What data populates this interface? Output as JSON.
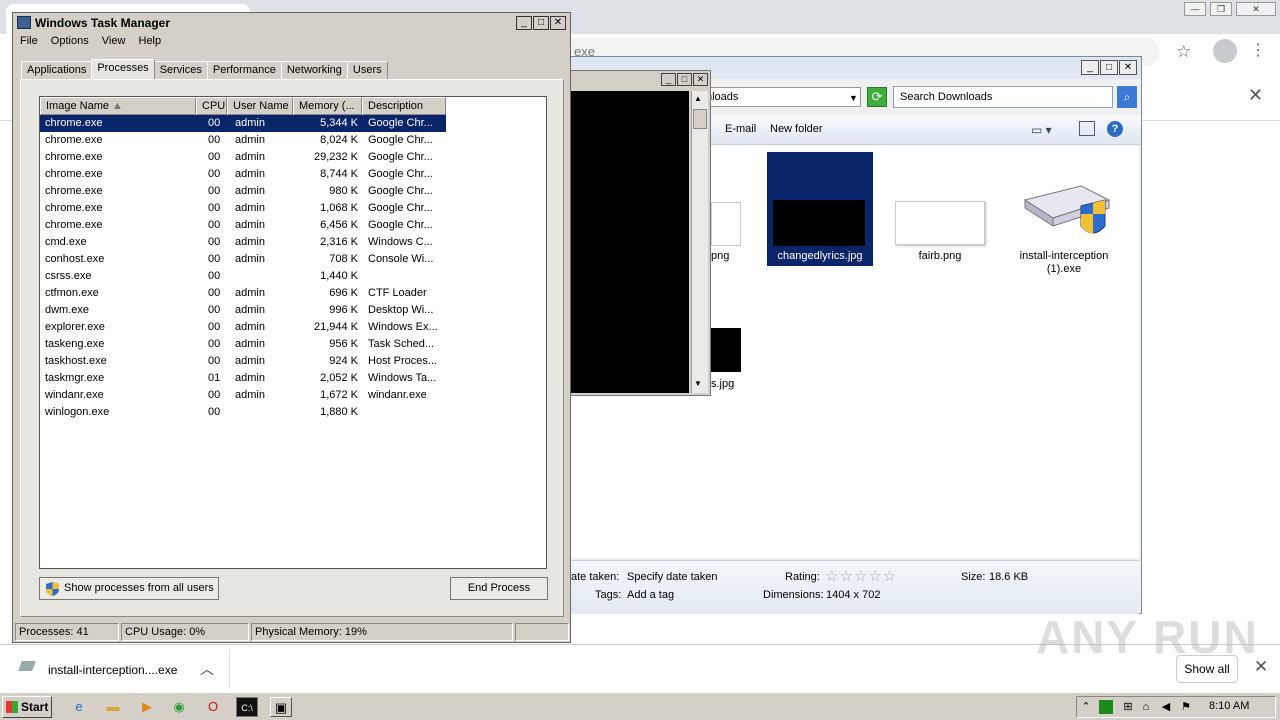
{
  "chrome": {
    "omnibox_text": "exe",
    "window_controls": [
      "—",
      "❐",
      "✕"
    ]
  },
  "explorer": {
    "address": "nloads",
    "search_placeholder": "Search Downloads",
    "toolbar": {
      "email": "E-mail",
      "new_folder": "New folder"
    },
    "files": [
      {
        "name": "changedlyrics.jpg"
      },
      {
        "name": "fairb.png"
      },
      {
        "name": "install-interception (1).exe"
      }
    ],
    "partial_labels": {
      "left1": "png",
      "left2": "s.jpg"
    },
    "details": {
      "date_taken_label": "ate taken:",
      "date_taken_value": "Specify date taken",
      "tags_label": "Tags:",
      "tags_value": "Add a tag",
      "rating_label": "Rating:",
      "rating_stars": "☆☆☆☆☆",
      "dimensions_label": "Dimensions:",
      "dimensions_value": "1404 x 702",
      "size_label": "Size:",
      "size_value": "18.6 KB"
    }
  },
  "taskmgr": {
    "title": "Windows Task Manager",
    "menu": [
      "File",
      "Options",
      "View",
      "Help"
    ],
    "tabs": [
      "Applications",
      "Processes",
      "Services",
      "Performance",
      "Networking",
      "Users"
    ],
    "active_tab": "Processes",
    "columns": [
      "Image Name",
      "CPU",
      "User Name",
      "Memory (...",
      "Description"
    ],
    "processes": [
      {
        "image": "chrome.exe",
        "cpu": "00",
        "user": "admin",
        "memory": "5,344 K",
        "desc": "Google Chr..."
      },
      {
        "image": "chrome.exe",
        "cpu": "00",
        "user": "admin",
        "memory": "8,024 K",
        "desc": "Google Chr..."
      },
      {
        "image": "chrome.exe",
        "cpu": "00",
        "user": "admin",
        "memory": "29,232 K",
        "desc": "Google Chr..."
      },
      {
        "image": "chrome.exe",
        "cpu": "00",
        "user": "admin",
        "memory": "8,744 K",
        "desc": "Google Chr..."
      },
      {
        "image": "chrome.exe",
        "cpu": "00",
        "user": "admin",
        "memory": "980 K",
        "desc": "Google Chr..."
      },
      {
        "image": "chrome.exe",
        "cpu": "00",
        "user": "admin",
        "memory": "1,068 K",
        "desc": "Google Chr..."
      },
      {
        "image": "chrome.exe",
        "cpu": "00",
        "user": "admin",
        "memory": "6,456 K",
        "desc": "Google Chr..."
      },
      {
        "image": "cmd.exe",
        "cpu": "00",
        "user": "admin",
        "memory": "2,316 K",
        "desc": "Windows C..."
      },
      {
        "image": "conhost.exe",
        "cpu": "00",
        "user": "admin",
        "memory": "708 K",
        "desc": "Console Wi..."
      },
      {
        "image": "csrss.exe",
        "cpu": "00",
        "user": "",
        "memory": "1,440 K",
        "desc": ""
      },
      {
        "image": "ctfmon.exe",
        "cpu": "00",
        "user": "admin",
        "memory": "696 K",
        "desc": "CTF Loader"
      },
      {
        "image": "dwm.exe",
        "cpu": "00",
        "user": "admin",
        "memory": "996 K",
        "desc": "Desktop Wi..."
      },
      {
        "image": "explorer.exe",
        "cpu": "00",
        "user": "admin",
        "memory": "21,944 K",
        "desc": "Windows Ex..."
      },
      {
        "image": "taskeng.exe",
        "cpu": "00",
        "user": "admin",
        "memory": "956 K",
        "desc": "Task Sched..."
      },
      {
        "image": "taskhost.exe",
        "cpu": "00",
        "user": "admin",
        "memory": "924 K",
        "desc": "Host Proces..."
      },
      {
        "image": "taskmgr.exe",
        "cpu": "01",
        "user": "admin",
        "memory": "2,052 K",
        "desc": "Windows Ta..."
      },
      {
        "image": "windanr.exe",
        "cpu": "00",
        "user": "admin",
        "memory": "1,672 K",
        "desc": "windanr.exe"
      },
      {
        "image": "winlogon.exe",
        "cpu": "00",
        "user": "",
        "memory": "1,880 K",
        "desc": ""
      }
    ],
    "show_all_button": "Show processes from all users",
    "end_process_button": "End Process",
    "status": {
      "processes": "Processes: 41",
      "cpu": "CPU Usage: 0%",
      "memory": "Physical Memory: 19%"
    }
  },
  "download_shelf": {
    "file_name": "install-interception....exe",
    "show_all": "Show all"
  },
  "watermark": "ANY RUN",
  "taskbar": {
    "start": "Start",
    "clock": "8:10 AM"
  }
}
